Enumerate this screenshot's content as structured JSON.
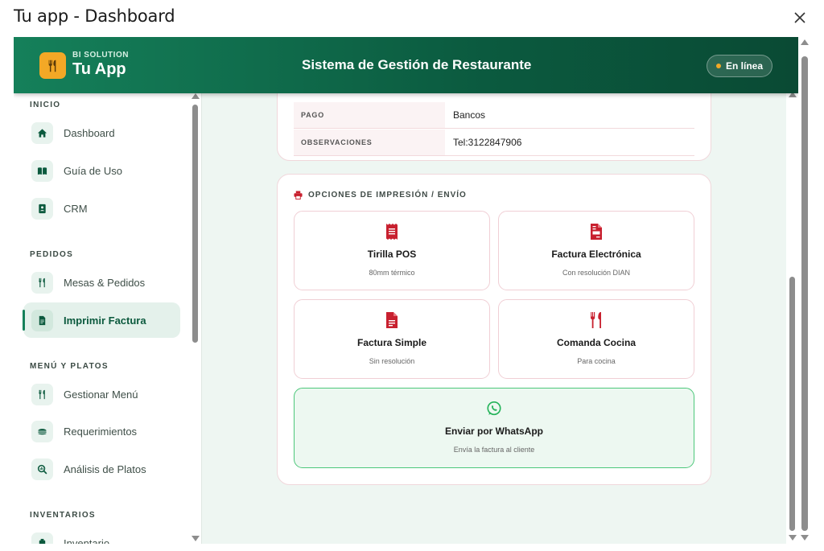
{
  "window": {
    "title": "Tu app - Dashboard"
  },
  "header": {
    "brand_top": "BI SOLUTION",
    "brand_name": "Tu App",
    "title": "Sistema de Gestión de Restaurante",
    "status": "En línea"
  },
  "sidebar": {
    "sections": [
      {
        "label": "INICIO"
      },
      {
        "label": "PEDIDOS"
      },
      {
        "label": "MENÚ Y PLATOS"
      },
      {
        "label": "INVENTARIOS"
      }
    ],
    "items": [
      {
        "label": "Dashboard",
        "icon": "home-icon"
      },
      {
        "label": "Guía de Uso",
        "icon": "book-icon"
      },
      {
        "label": "CRM",
        "icon": "contacts-icon"
      },
      {
        "label": "Mesas & Pedidos",
        "icon": "utensils-icon"
      },
      {
        "label": "Imprimir Factura",
        "icon": "invoice-icon",
        "active": true
      },
      {
        "label": "Gestionar Menú",
        "icon": "utensils-icon"
      },
      {
        "label": "Requerimientos",
        "icon": "burger-icon"
      },
      {
        "label": "Análisis de Platos",
        "icon": "search-chart-icon"
      },
      {
        "label": "Inventario",
        "icon": "inventory-icon"
      }
    ]
  },
  "details": [
    {
      "key": "PAGO",
      "value": "Bancos"
    },
    {
      "key": "OBSERVACIONES",
      "value": "Tel:3122847906"
    }
  ],
  "print_options": {
    "heading": "OPCIONES DE IMPRESIÓN / ENVÍO",
    "options": [
      {
        "title": "Tirilla POS",
        "subtitle": "80mm térmico",
        "icon": "receipt-icon"
      },
      {
        "title": "Factura Electrónica",
        "subtitle": "Con resolución DIAN",
        "icon": "file-invoice-icon"
      },
      {
        "title": "Factura Simple",
        "subtitle": "Sin resolución",
        "icon": "file-icon"
      },
      {
        "title": "Comanda Cocina",
        "subtitle": "Para cocina",
        "icon": "utensils-icon"
      },
      {
        "title": "Enviar por WhatsApp",
        "subtitle": "Envía la factura al cliente",
        "icon": "whatsapp-icon"
      }
    ]
  },
  "colors": {
    "brand_green": "#15805a",
    "brand_dark": "#0a4a34",
    "logo_orange": "#f3a826",
    "accent_red": "#c8202f",
    "whatsapp_green": "#25b35a"
  }
}
